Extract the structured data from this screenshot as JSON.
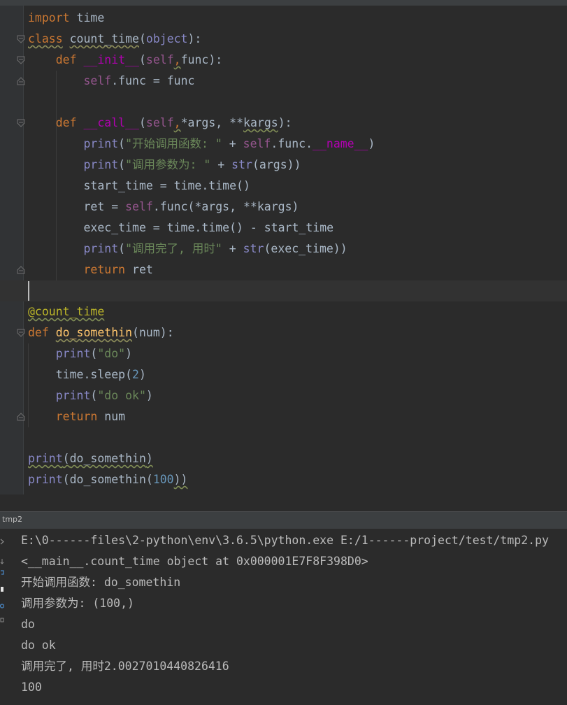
{
  "editor": {
    "lines": {
      "l1": {
        "a": "import",
        "b": " time"
      },
      "l2": {
        "a": "class",
        "b": " ",
        "c": "count_time",
        "d": "(",
        "e": "object",
        "f": "):"
      },
      "l3": {
        "a": "    ",
        "b": "def",
        "c": " ",
        "d": "__init__",
        "e": "(",
        "f": "self",
        "g": ",",
        "h": "func",
        "i": "):"
      },
      "l4": {
        "a": "        ",
        "b": "self",
        "c": ".func = func"
      },
      "l6": {
        "a": "    ",
        "b": "def",
        "c": " ",
        "d": "__call__",
        "e": "(",
        "f": "self",
        "g": ",",
        "h": "*args, **",
        "i": "kargs",
        "j": "):"
      },
      "l7": {
        "a": "        ",
        "b": "print",
        "c": "(",
        "d": "\"开始调用函数: \"",
        "e": " + ",
        "f": "self",
        "g": ".func.",
        "h": "__name__",
        "i": ")"
      },
      "l8": {
        "a": "        ",
        "b": "print",
        "c": "(",
        "d": "\"调用参数为: \"",
        "e": " + ",
        "f": "str",
        "g": "(args))"
      },
      "l9": {
        "a": "        start_time = time.time()"
      },
      "l10": {
        "a": "        ret = ",
        "b": "self",
        "c": ".func(*args, **kargs)"
      },
      "l11": {
        "a": "        exec_time = time.time() - start_time"
      },
      "l12": {
        "a": "        ",
        "b": "print",
        "c": "(",
        "d": "\"调用完了, 用时\"",
        "e": " + ",
        "f": "str",
        "g": "(exec_time))"
      },
      "l13": {
        "a": "        ",
        "b": "return",
        "c": " ret"
      },
      "l15": {
        "a": "@count_time"
      },
      "l16": {
        "a": "def",
        "b": " ",
        "c": "do_somethin",
        "d": "(num):"
      },
      "l17": {
        "a": "    ",
        "b": "print",
        "c": "(",
        "d": "\"do\"",
        "e": ")"
      },
      "l18": {
        "a": "    time.sleep(",
        "b": "2",
        "c": ")"
      },
      "l19": {
        "a": "    ",
        "b": "print",
        "c": "(",
        "d": "\"do ok\"",
        "e": ")"
      },
      "l20": {
        "a": "    ",
        "b": "return",
        "c": " num"
      },
      "l22": {
        "a": "print",
        "b": "(",
        "c": "do_somethin",
        "d": ")"
      },
      "l23": {
        "a": "print",
        "b": "(do_somethin(",
        "c": "100",
        "d": "))"
      }
    }
  },
  "run_panel": {
    "tab_label": "tmp2",
    "output": [
      "E:\\0------files\\2-python\\env\\3.6.5\\python.exe E:/1------project/test/tmp2.py",
      "<__main__.count_time object at 0x000001E7F8F398D0>",
      "开始调用函数: do_somethin",
      "调用参数为: (100,)",
      "do",
      "do ok",
      "调用完了, 用时2.0027010440826416",
      "100"
    ]
  },
  "colors": {
    "background": "#2b2b2b",
    "keyword": "#cc7832",
    "self": "#94558d",
    "string": "#6a8759",
    "number": "#6897bb",
    "function_name": "#ffc66d",
    "builtin": "#8888c6",
    "decorator": "#bbb529",
    "text": "#a9b7c6"
  }
}
